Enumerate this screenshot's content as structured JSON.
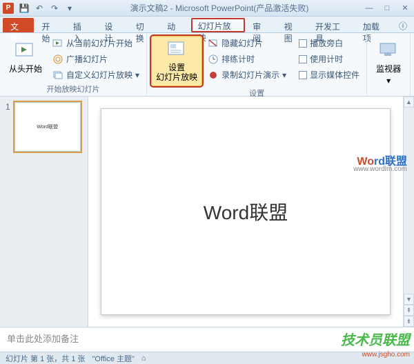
{
  "titlebar": {
    "app_icon_letter": "P",
    "title": "演示文稿2 - Microsoft PowerPoint(产品激活失败)",
    "qat": {
      "save": "💾",
      "undo": "↶",
      "redo": "↷",
      "more": "▾"
    },
    "win": {
      "min": "—",
      "max": "□",
      "close": "✕"
    }
  },
  "tabs": {
    "file": "文件",
    "items": [
      "开始",
      "插入",
      "设计",
      "切换",
      "动画",
      "幻灯片放映",
      "审阅",
      "视图",
      "开发工具",
      "加载项"
    ],
    "active_index": 5,
    "help": "ⓘ"
  },
  "ribbon": {
    "group1": {
      "label": "开始放映幻灯片",
      "from_start": "从头开始",
      "from_current": "从当前幻灯片开始",
      "broadcast": "广播幻灯片",
      "custom": "自定义幻灯片放映"
    },
    "group2": {
      "label": "设置",
      "setup": "设置\n幻灯片放映",
      "hide": "隐藏幻灯片",
      "rehearse": "排练计时",
      "record": "录制幻灯片演示",
      "narration": "播放旁白",
      "timings": "使用计时",
      "media": "显示媒体控件"
    },
    "group3": {
      "label": "",
      "monitor": "监视器"
    }
  },
  "thumbnails": {
    "items": [
      {
        "num": "1",
        "preview": "Word联盟"
      }
    ]
  },
  "slide": {
    "title": "Word联盟"
  },
  "notes": {
    "placeholder": "单击此处添加备注"
  },
  "statusbar": {
    "slide_info": "幻灯片 第 1 张，共 1 张",
    "theme": "\"Office 主题\"",
    "lang": "⌂"
  },
  "watermarks": {
    "w1a": "Wo",
    "w1b": "rd联盟",
    "w1_url": "www.wordlm.com",
    "w2": "技术员联盟",
    "w2_url": "www.jsgho.com"
  }
}
